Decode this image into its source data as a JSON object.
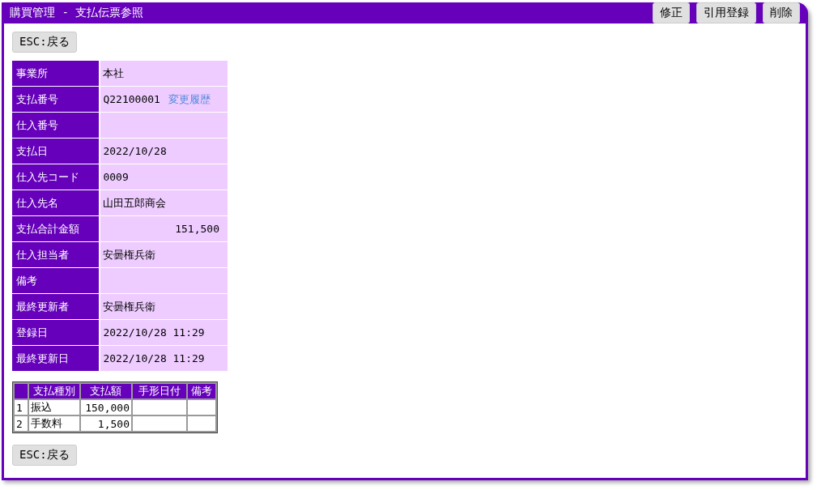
{
  "window": {
    "title": "購買管理 - 支払伝票参照"
  },
  "header_buttons": [
    "修正",
    "引用登録",
    "削除"
  ],
  "back_button_top": "ESC:戻る",
  "fields": [
    {
      "label": "事業所",
      "value": "本社",
      "kind": "text"
    },
    {
      "label": "支払番号",
      "value": "Q22100001",
      "link": "変更履歴",
      "kind": "text"
    },
    {
      "label": "仕入番号",
      "kind": "text"
    },
    {
      "label": "支払日",
      "value": "2022/10/28",
      "kind": "text"
    },
    {
      "label": "仕入先コード",
      "value": "0009",
      "kind": "text"
    },
    {
      "label": "仕入先名",
      "value": "山田五郎商会",
      "kind": "text"
    },
    {
      "label": "支払合計金額",
      "value": "151,500",
      "kind": "amount"
    },
    {
      "label": "仕入担当者",
      "value": "安曇権兵衛",
      "kind": "text"
    },
    {
      "label": "備考",
      "kind": "text"
    },
    {
      "label": "最終更新者",
      "value": "安曇権兵衛",
      "kind": "text"
    },
    {
      "label": "登録日",
      "value": "2022/10/28 11:29",
      "kind": "text"
    },
    {
      "label": "最終更新日",
      "value": "2022/10/28 11:29",
      "kind": "text"
    }
  ],
  "payments": {
    "columns": [
      "支払種別",
      "支払額",
      "手形日付",
      "備考"
    ],
    "rows": [
      {
        "no": "1",
        "type": "振込",
        "amount": "150,000"
      },
      {
        "no": "2",
        "type": "手数料",
        "amount": "1,500"
      }
    ]
  },
  "back_button_bottom": "ESC:戻る"
}
